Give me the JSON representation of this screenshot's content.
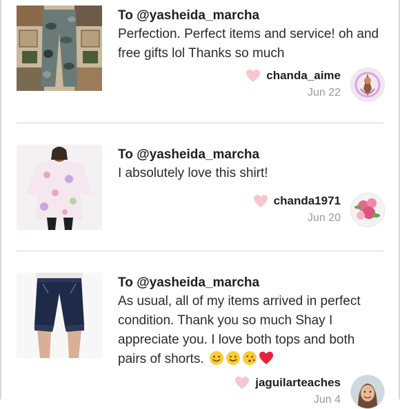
{
  "reviews": [
    {
      "to_prefix": "To ",
      "to_handle": "@yasheida_marcha",
      "text": "Perfection. Perfect items and service! oh and free gifts lol Thanks so much",
      "username": "chanda_aime",
      "date": "Jun 22",
      "thumb": "camo-pants-photo",
      "avatar": "illustration-avatar"
    },
    {
      "to_prefix": "To ",
      "to_handle": "@yasheida_marcha",
      "text": "I absolutely love this shirt!",
      "username": "chanda1971",
      "date": "Jun 20",
      "thumb": "floral-shirt-photo",
      "avatar": "rose-avatar"
    },
    {
      "to_prefix": "To ",
      "to_handle": "@yasheida_marcha",
      "text": "As usual, all of my items arrived in perfect condition. Thank you so much Shay I appreciate you. I love both tops and both pairs of shorts.",
      "emojis": [
        "smiling-face",
        "winking-face",
        "face-blowing-kiss",
        "red-heart"
      ],
      "username": "jaguilarteaches",
      "date": "Jun 4",
      "thumb": "denim-shorts-photo",
      "avatar": "portrait-avatar"
    }
  ],
  "colors": {
    "heart": "#f6c7cf",
    "date": "#9a9a9a",
    "divider": "#d6d6d6"
  }
}
